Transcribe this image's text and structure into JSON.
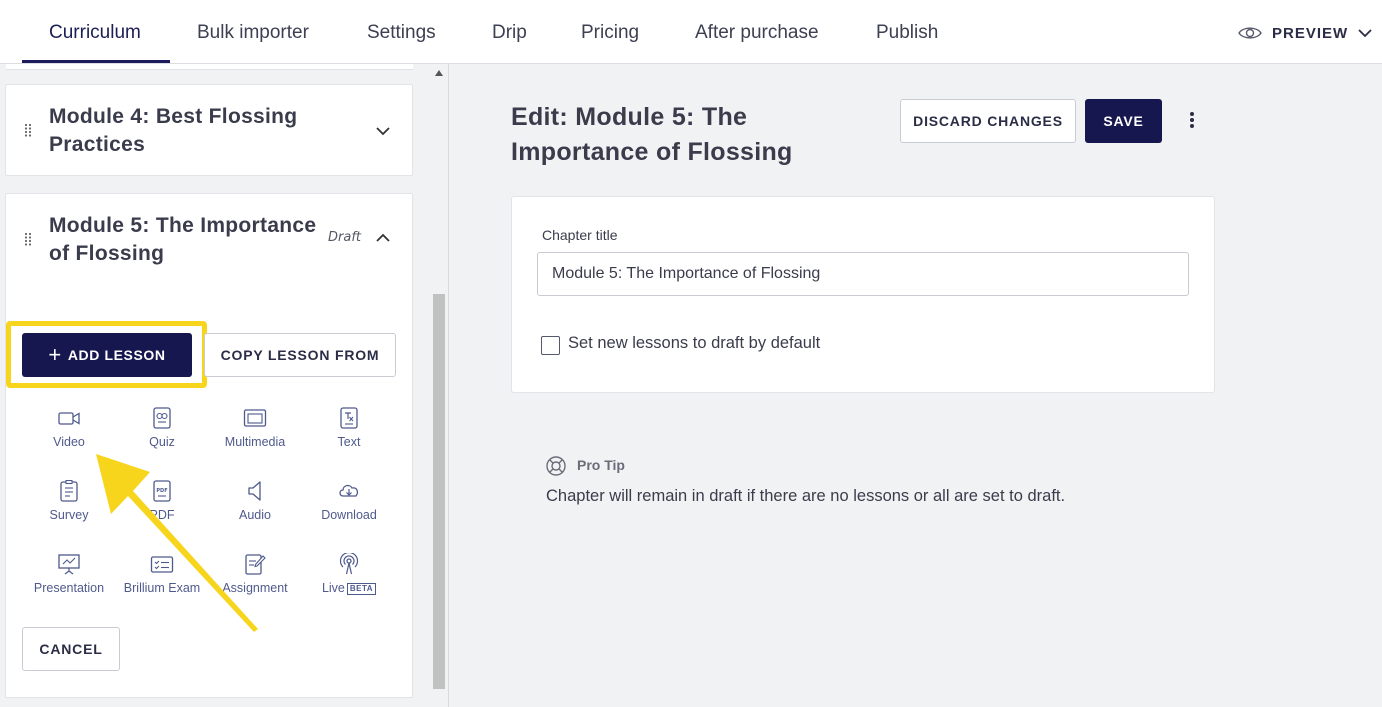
{
  "nav": {
    "tabs": [
      {
        "label": "Curriculum"
      },
      {
        "label": "Bulk importer"
      },
      {
        "label": "Settings"
      },
      {
        "label": "Drip"
      },
      {
        "label": "Pricing"
      },
      {
        "label": "After purchase"
      },
      {
        "label": "Publish"
      }
    ],
    "active_tab": "Curriculum",
    "preview_label": "PREVIEW"
  },
  "sidebar": {
    "modules": [
      {
        "title": "Module 4: Best Flossing Practices",
        "expanded": false,
        "status": ""
      },
      {
        "title": "Module 5: The Importance of Flossing",
        "expanded": true,
        "status": "Draft"
      }
    ],
    "add_lesson_label": "ADD LESSON",
    "copy_lesson_label": "COPY LESSON FROM",
    "lesson_types": [
      {
        "label": "Video",
        "icon": "video-icon"
      },
      {
        "label": "Quiz",
        "icon": "quiz-icon"
      },
      {
        "label": "Multimedia",
        "icon": "multimedia-icon"
      },
      {
        "label": "Text",
        "icon": "text-icon"
      },
      {
        "label": "Survey",
        "icon": "survey-icon"
      },
      {
        "label": "PDF",
        "icon": "pdf-icon"
      },
      {
        "label": "Audio",
        "icon": "audio-icon"
      },
      {
        "label": "Download",
        "icon": "download-icon"
      },
      {
        "label": "Presentation",
        "icon": "presentation-icon"
      },
      {
        "label": "Brillium Exam",
        "icon": "brillium-exam-icon"
      },
      {
        "label": "Assignment",
        "icon": "assignment-icon"
      },
      {
        "label": "Live",
        "icon": "live-icon",
        "badge": "BETA"
      }
    ],
    "cancel_label": "CANCEL"
  },
  "editor": {
    "heading": "Edit: Module 5: The Importance of Flossing",
    "discard_label": "DISCARD CHANGES",
    "save_label": "SAVE",
    "chapter_title_label": "Chapter title",
    "chapter_title_value": "Module 5: The Importance of Flossing",
    "draft_default_label": "Set new lessons to draft by default",
    "draft_default_checked": false,
    "pro_tip_title": "Pro Tip",
    "pro_tip_text": "Chapter will remain in draft if there are no lessons or all are set to draft."
  },
  "colors": {
    "primary": "#17174f",
    "highlight": "#f7d51c",
    "link": "#4f5a8c"
  }
}
